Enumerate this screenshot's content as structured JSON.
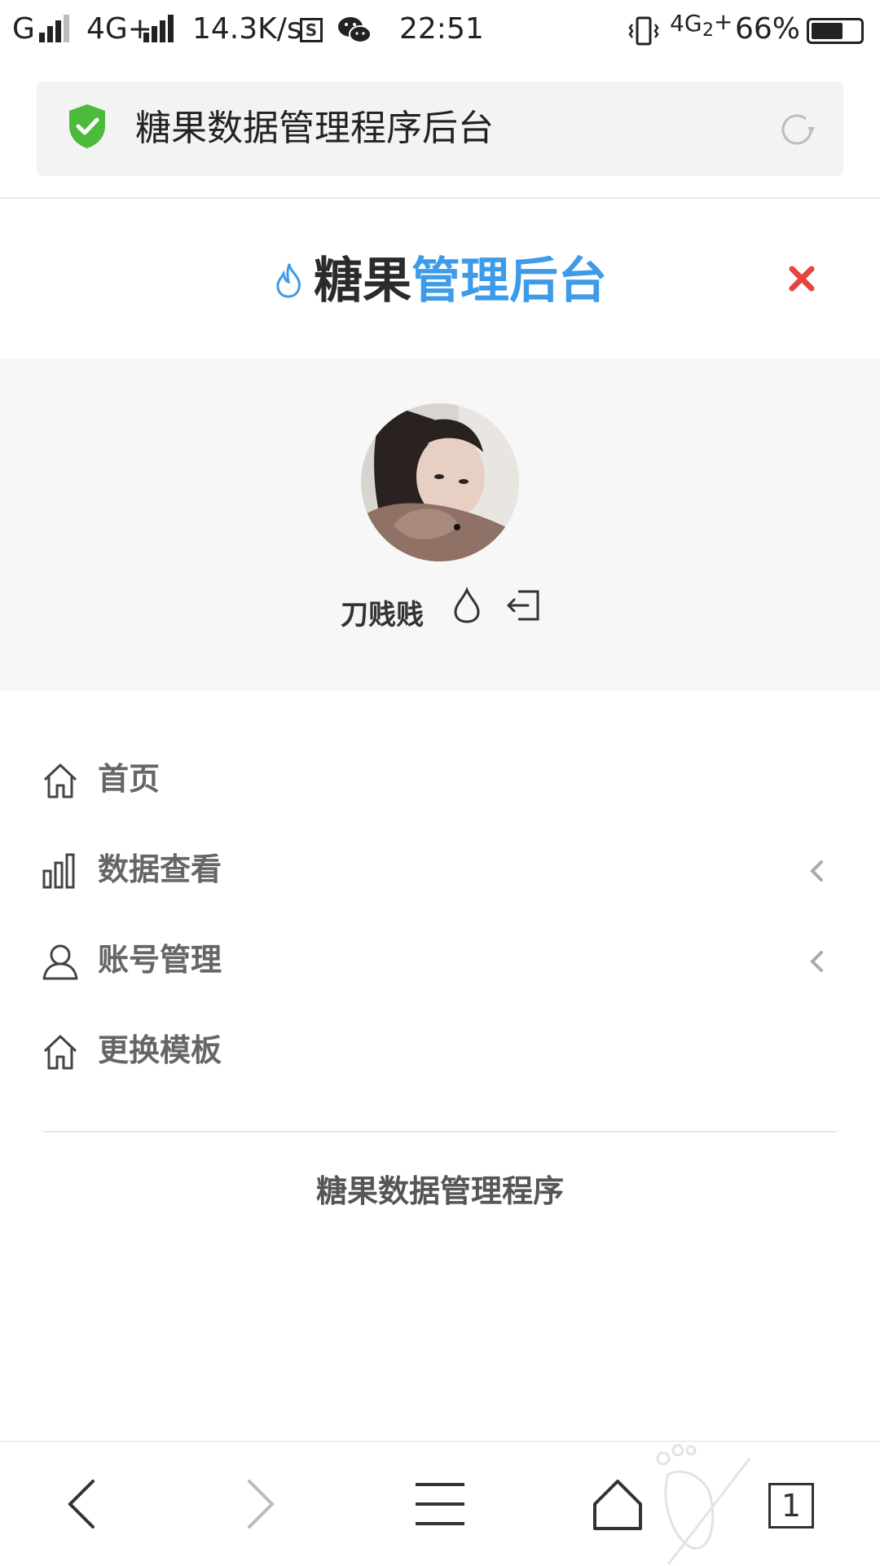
{
  "status_bar": {
    "carrier_1": "G",
    "carrier_2": "4G+",
    "net_speed": "14.3K/s",
    "time": "22:51",
    "network_right": "4G",
    "network_right_sub": "2",
    "network_right_plus": "+",
    "battery": "66%",
    "battery_level": 0.66,
    "icons": [
      "signal-icon",
      "signal-icon",
      "s-app-icon",
      "wechat-icon",
      "vibrate-icon",
      "battery-icon"
    ]
  },
  "browser": {
    "page_title": "糖果数据管理程序后台",
    "secure_icon": "shield-check-icon",
    "reload_icon": "reload-icon"
  },
  "header": {
    "title_part1": "糖果",
    "title_part2": "管理后台",
    "flame_icon": "flame-icon",
    "close_icon": "close-icon",
    "accent_color": "#3d9be9",
    "close_color": "#e8443f"
  },
  "profile": {
    "username": "刀贱贱",
    "icons": [
      "drop-icon",
      "logout-icon"
    ]
  },
  "menu": {
    "items": [
      {
        "label": "首页",
        "icon": "home-icon",
        "has_submenu": false
      },
      {
        "label": "数据查看",
        "icon": "bar-chart-icon",
        "has_submenu": true
      },
      {
        "label": "账号管理",
        "icon": "user-icon",
        "has_submenu": true
      },
      {
        "label": "更换模板",
        "icon": "home-icon",
        "has_submenu": false
      }
    ]
  },
  "footer": {
    "text": "糖果数据管理程序"
  },
  "bottom_nav": {
    "buttons": [
      "back-icon",
      "forward-icon",
      "menu-icon",
      "home-icon",
      "tabs-icon"
    ],
    "tab_count": "1"
  }
}
